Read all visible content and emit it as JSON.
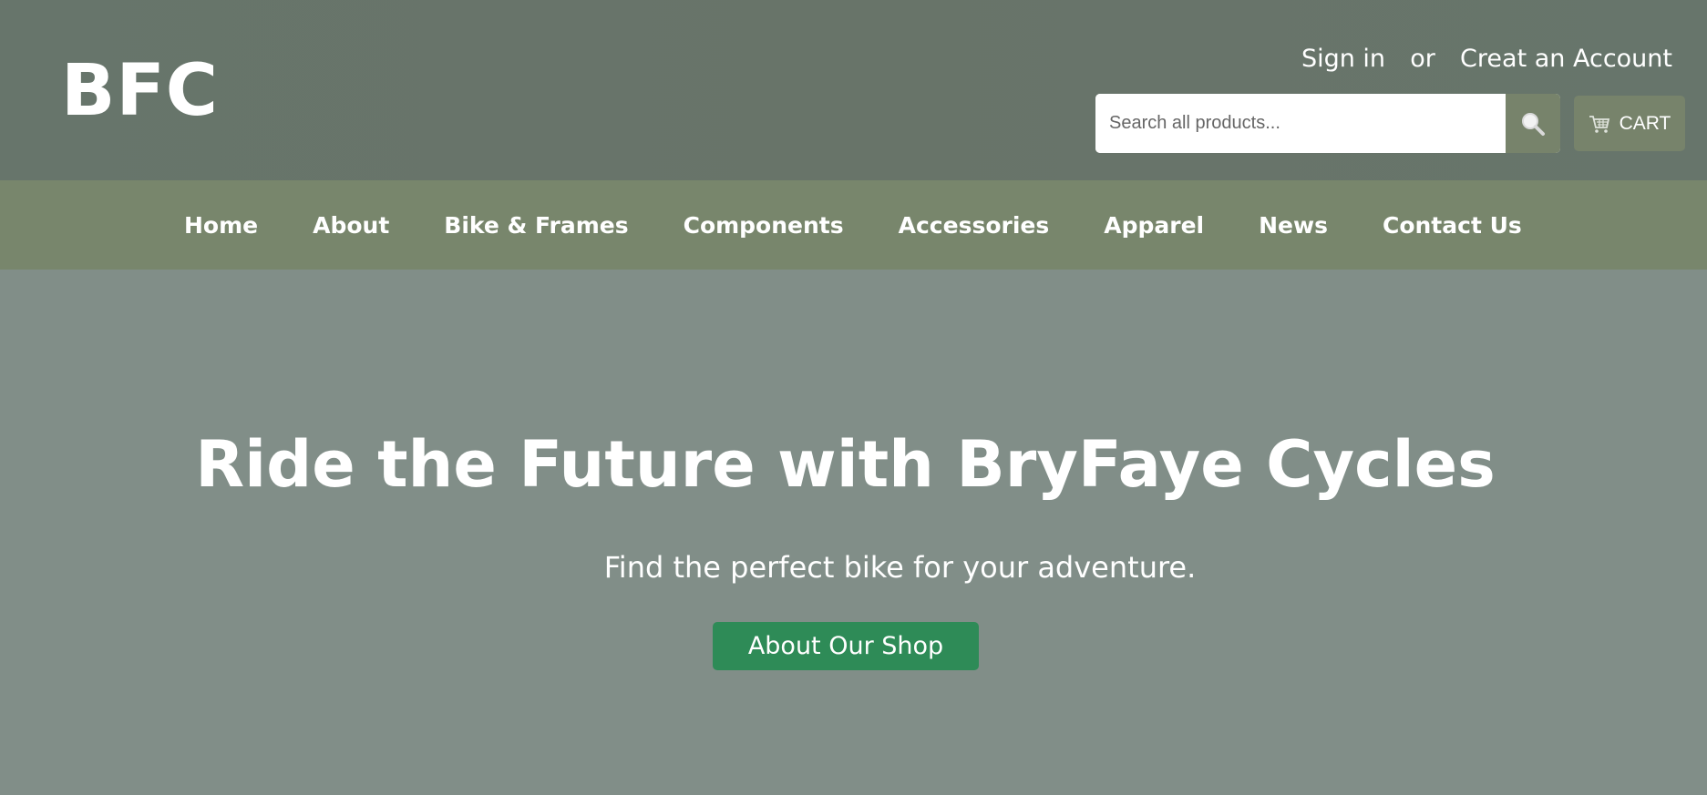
{
  "header": {
    "logo": "BFC",
    "sign_in": "Sign in",
    "or": "or",
    "create_account": "Creat an Account",
    "search": {
      "placeholder": "Search all products...",
      "icon": "search-icon"
    },
    "cart": {
      "label": "CART",
      "icon": "cart-icon"
    }
  },
  "nav": {
    "items": [
      {
        "label": "Home"
      },
      {
        "label": "About"
      },
      {
        "label": "Bike & Frames"
      },
      {
        "label": "Components"
      },
      {
        "label": "Accessories"
      },
      {
        "label": "Apparel"
      },
      {
        "label": "News"
      },
      {
        "label": "Contact Us"
      }
    ]
  },
  "hero": {
    "title": "Ride the Future with BryFaye Cycles",
    "subtitle": "Find the perfect bike for your adventure.",
    "button_label": "About Our Shop"
  },
  "colors": {
    "header_bg": "#67756b",
    "nav_bg": "#78866c",
    "hero_bg": "#818e88",
    "cta_button": "#2e8b57",
    "accent": "#77836b"
  }
}
